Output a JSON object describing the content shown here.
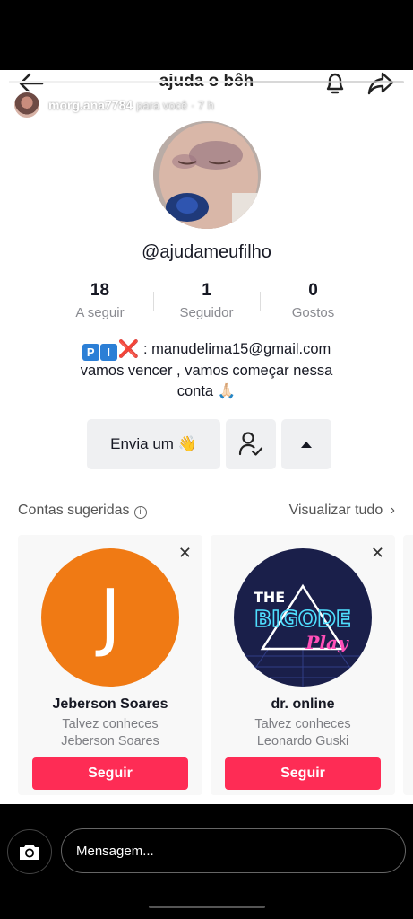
{
  "header": {
    "title": "ajuda o bêh"
  },
  "story": {
    "username": "morg.ana7784",
    "meta": "para você · 7 h",
    "progress": 0.6
  },
  "profile": {
    "handle": "@ajudameufilho",
    "stats": [
      {
        "value": "18",
        "label": "A seguir"
      },
      {
        "value": "1",
        "label": "Seguidor"
      },
      {
        "value": "0",
        "label": "Gostos"
      }
    ],
    "bio": {
      "pix_letters": [
        "P",
        "I"
      ],
      "pix_mark": "❌",
      "email_text": ": manudelima15@gmail.com",
      "line2": "vamos vencer , vamos começar nessa",
      "line3": "conta 🙏🏻"
    },
    "buttons": {
      "message": "Envia um 👋",
      "friend_icon": "person-check-icon",
      "more_icon": "caret-up-icon"
    }
  },
  "suggestions": {
    "title": "Contas sugeridas",
    "view_all": "Visualizar tudo",
    "cards": [
      {
        "avatar_letter": "J",
        "avatar_color": "#f07a14",
        "name": "Jeberson Soares",
        "sub1": "Talvez conheces",
        "sub2": "Jeberson Soares",
        "button": "Seguir"
      },
      {
        "avatar_logo": [
          "THE",
          "BIGODE",
          "Play"
        ],
        "name": "dr. online",
        "sub1": "Talvez conheces",
        "sub2": "Leonardo Guski",
        "button": "Seguir"
      }
    ]
  },
  "bottom_bar": {
    "message_placeholder": "Mensagem..."
  },
  "colors": {
    "follow": "#fe2c55",
    "button_bg": "#eff0f2",
    "text": "#161823",
    "muted": "#8a8b91"
  }
}
